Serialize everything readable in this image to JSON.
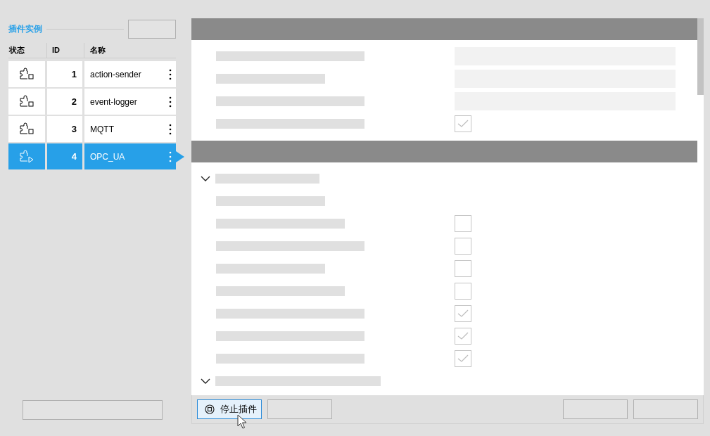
{
  "plugin_panel": {
    "title": "插件实例",
    "columns": [
      "状态",
      "ID",
      "名称"
    ],
    "rows": [
      {
        "id": "1",
        "name": "action-sender",
        "running": false,
        "selected": false
      },
      {
        "id": "2",
        "name": "event-logger",
        "running": false,
        "selected": false
      },
      {
        "id": "3",
        "name": "MQTT",
        "running": false,
        "selected": false
      },
      {
        "id": "4",
        "name": "OPC_UA",
        "running": true,
        "selected": true
      }
    ]
  },
  "detail": {
    "sections": [
      {
        "rows": [
          {
            "kind": "field"
          },
          {
            "kind": "field"
          },
          {
            "kind": "field"
          },
          {
            "kind": "checkbox",
            "checked": true
          }
        ]
      },
      {
        "groups": [
          {
            "expanded": true,
            "rows": [
              {
                "kind": "label"
              },
              {
                "kind": "checkbox",
                "checked": false
              },
              {
                "kind": "checkbox",
                "checked": false
              },
              {
                "kind": "checkbox",
                "checked": false
              },
              {
                "kind": "checkbox",
                "checked": false
              },
              {
                "kind": "checkbox",
                "checked": true
              },
              {
                "kind": "checkbox",
                "checked": true
              },
              {
                "kind": "checkbox",
                "checked": true
              }
            ]
          },
          {
            "expanded": true
          }
        ]
      }
    ]
  },
  "footer": {
    "stop_button": "停止插件"
  }
}
